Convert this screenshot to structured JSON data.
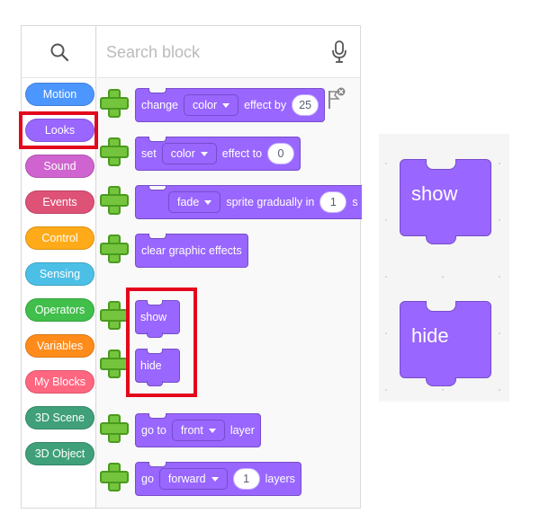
{
  "search": {
    "placeholder": "Search block"
  },
  "categories": [
    {
      "label": "Motion",
      "color": "#4c97ff"
    },
    {
      "label": "Looks",
      "color": "#9966ff",
      "selected": true
    },
    {
      "label": "Sound",
      "color": "#cf63cf"
    },
    {
      "label": "Events",
      "color": "#de5277"
    },
    {
      "label": "Control",
      "color": "#ffab19"
    },
    {
      "label": "Sensing",
      "color": "#4cbfe6"
    },
    {
      "label": "Operators",
      "color": "#40bf4a"
    },
    {
      "label": "Variables",
      "color": "#ff8c1a"
    },
    {
      "label": "My Blocks",
      "color": "#ff6680"
    },
    {
      "label": "3D Scene",
      "color": "#3fa07a"
    },
    {
      "label": "3D Object",
      "color": "#3fa07a"
    }
  ],
  "blocks": {
    "change_effect": {
      "text1": "change",
      "dropdown": "color",
      "text2": "effect by",
      "value": "25"
    },
    "set_effect": {
      "text1": "set",
      "dropdown": "color",
      "text2": "effect to",
      "value": "0"
    },
    "fade_sprite": {
      "dropdown": "fade",
      "text1": "sprite gradually in",
      "value": "1",
      "text2": "s"
    },
    "clear_effects": {
      "text1": "clear graphic effects"
    },
    "show": {
      "text1": "show"
    },
    "hide": {
      "text1": "hide"
    },
    "go_to_layer": {
      "text1": "go to",
      "dropdown": "front",
      "text2": "layer"
    },
    "go_layers": {
      "text1": "go",
      "dropdown": "forward",
      "value": "1",
      "text2": "layers"
    }
  },
  "preview": {
    "show_label": "show",
    "hide_label": "hide"
  },
  "colors": {
    "looks": "#9966ff",
    "highlight": "#e3061c",
    "add": "#74c43e"
  }
}
